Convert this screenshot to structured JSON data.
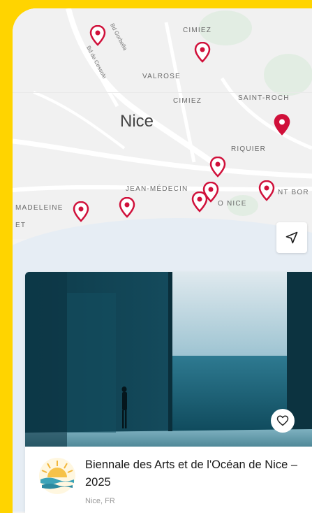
{
  "map": {
    "labels": {
      "cimiez_top": "CIMIEZ",
      "valrose": "VALROSE",
      "cimiez": "CIMIEZ",
      "saint_roch": "SAINT-ROCH",
      "city": "Nice",
      "riquier": "RIQUIER",
      "jean_medecin": "JEAN-MÉDECIN",
      "nice_port": "O NICE",
      "port_bor": "NT BOR",
      "madeleine": "MADELEINE",
      "et": "ET",
      "bd_gorbella": "Bd Gorbella",
      "bd_cessole": "Bd de Cessole"
    },
    "colors": {
      "pin": "#d0103a",
      "background": "#f1f1f1",
      "accent": "#ffd400"
    }
  },
  "controls": {
    "locate_icon": "navigation-arrow-icon"
  },
  "card": {
    "title": "Biennale des Arts et de l'Océan de Nice – 2025",
    "location": "Nice, FR",
    "favorite_icon": "heart-icon"
  }
}
